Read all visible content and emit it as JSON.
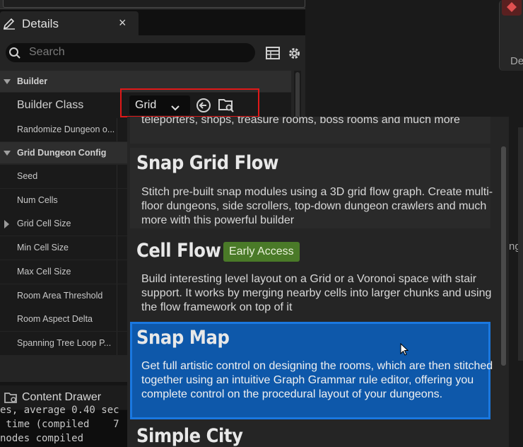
{
  "details_tab": {
    "title": "Details",
    "close": "×"
  },
  "search": {
    "placeholder": "Search"
  },
  "categories": {
    "builder": "Builder",
    "grid_config": "Grid Dungeon Config"
  },
  "builder_class": {
    "label": "Builder Class",
    "value": "Grid"
  },
  "rows": {
    "randomize": "Randomize Dungeon o...",
    "seed": "Seed",
    "num_cells": "Num Cells",
    "grid_cell_size": "Grid Cell Size",
    "min_cell_size": "Min Cell Size",
    "max_cell_size": "Max Cell Size",
    "room_area_threshold": "Room Area Threshold",
    "room_aspect_delta": "Room Aspect Delta",
    "spanning_tree": "Spanning Tree Loop P..."
  },
  "content_drawer": {
    "label": "Content Drawer"
  },
  "log": {
    "line1": "es, average 0.40 sec",
    "line2": " time (compiled    7",
    "line3": "nodes compiled"
  },
  "right_panel": {
    "node_text": "De",
    "side_text": "ng"
  },
  "popup": {
    "items": [
      {
        "desc_partial": "teleporters, shops, treasure rooms, boss rooms and much more"
      },
      {
        "title": "Snap Grid Flow",
        "desc": "Stitch pre-built snap modules using a 3D grid flow graph. Create multi-floor dungeons, side scrollers, top-down dungeon crawlers and much more with this powerful builder"
      },
      {
        "title": "Cell Flow",
        "badge": "Early Access",
        "desc": "Build interesting level layout on a Grid or a Voronoi space with stair support.   It works by merging nearby cells into larger chunks and using the flow framework on top of it"
      },
      {
        "title": "Snap Map",
        "desc": "Get full artistic control on designing the rooms, which are then stitched together using an intuitive Graph Grammar rule editor, offering you complete control on the procedural layout of your dungeons."
      },
      {
        "title": "Simple City"
      }
    ]
  },
  "colors": {
    "selection": "#0e58aa",
    "selection_border": "#1a78e0",
    "badge": "#4a7a28",
    "highlight_box": "#e01818"
  }
}
